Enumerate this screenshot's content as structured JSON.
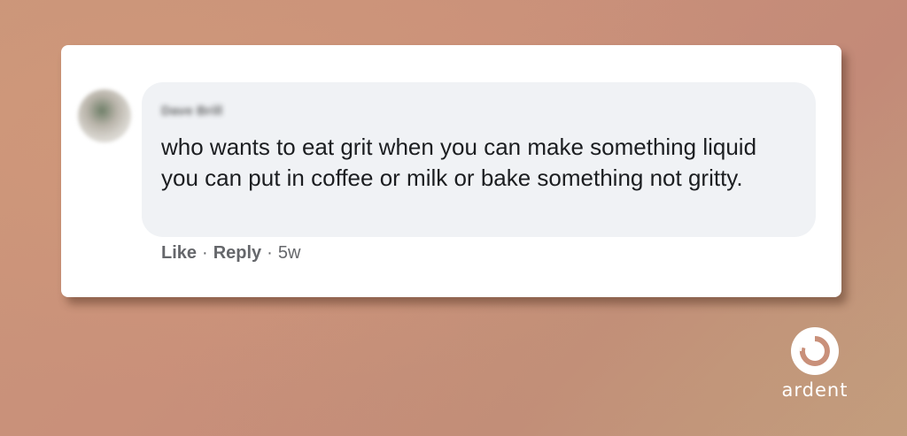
{
  "comment": {
    "author": "Dave Brill",
    "text": "who wants to eat grit when you can make something liquid you can put in coffee or milk or bake something not gritty.",
    "actions": {
      "like_label": "Like",
      "separator": "·",
      "reply_label": "Reply",
      "timestamp": "5w"
    },
    "avatar_icon": "user-avatar"
  },
  "brand": {
    "name": "ardent",
    "logo_icon": "ardent-logo-icon"
  },
  "colors": {
    "card": "#ffffff",
    "bubble": "#f0f2f5",
    "text": "#1c1e21",
    "meta_text": "#65676b",
    "background": "#c9907a"
  }
}
